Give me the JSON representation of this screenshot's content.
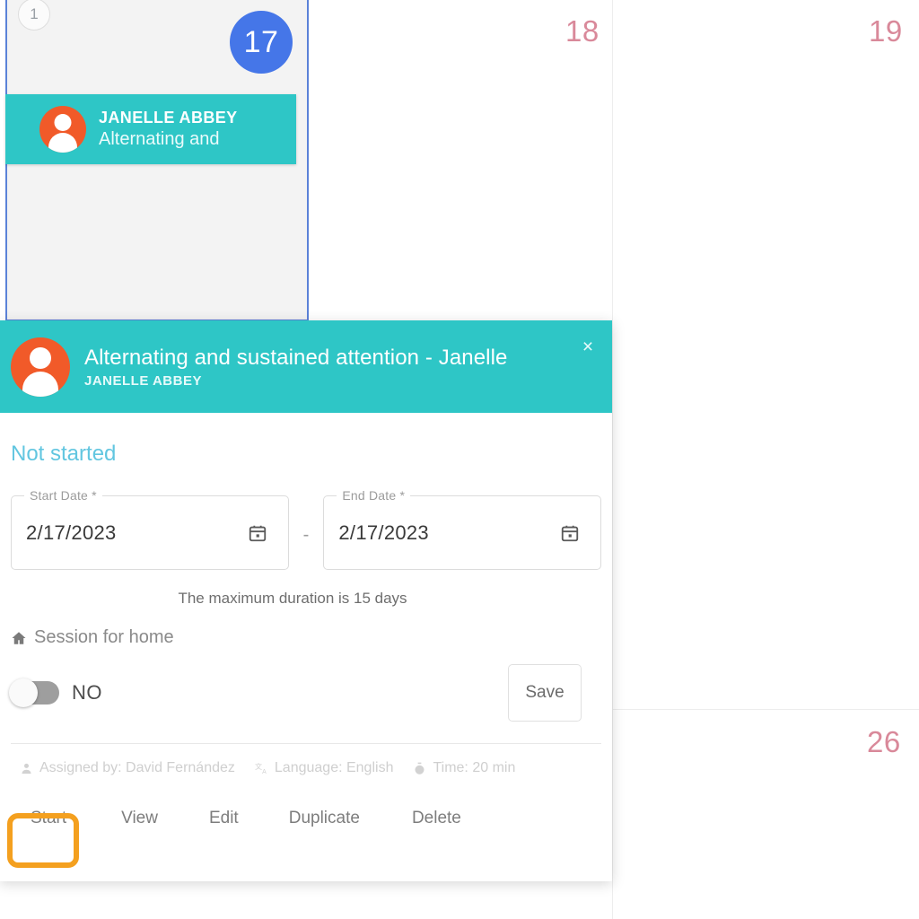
{
  "calendar": {
    "selected_day": {
      "number": "17",
      "event_count": "1",
      "event": {
        "client": "JANELLE ABBEY",
        "title": "Alternating and",
        "avatar_icon": "user-avatar-icon"
      }
    },
    "other_days": [
      {
        "number": "18"
      },
      {
        "number": "19"
      },
      {
        "number": "26"
      }
    ]
  },
  "popup": {
    "header": {
      "title": "Alternating and sustained attention - Janelle",
      "subtitle": "JANELLE ABBEY",
      "avatar_icon": "user-avatar-icon",
      "close_icon": "close-icon",
      "close_label": "×"
    },
    "status": "Not started",
    "start_date": {
      "label": "Start Date *",
      "value": "2/17/2023",
      "icon": "calendar-icon"
    },
    "date_separator": "-",
    "end_date": {
      "label": "End Date *",
      "value": "2/17/2023",
      "icon": "calendar-icon"
    },
    "max_duration_note": "The maximum duration is 15 days",
    "session_for_home": {
      "label": "Session for home",
      "icon": "home-icon",
      "toggle_value": "NO",
      "toggle_state": "off"
    },
    "save_label": "Save",
    "meta": [
      {
        "icon": "person-icon",
        "text": "Assigned by: David Fernández"
      },
      {
        "icon": "language-icon",
        "text": "Language: English"
      },
      {
        "icon": "stopwatch-icon",
        "text": "Time: 20 min"
      }
    ],
    "actions": [
      {
        "key": "start",
        "label": "Start"
      },
      {
        "key": "view",
        "label": "View"
      },
      {
        "key": "edit",
        "label": "Edit"
      },
      {
        "key": "duplicate",
        "label": "Duplicate"
      },
      {
        "key": "delete",
        "label": "Delete"
      }
    ]
  },
  "colors": {
    "teal": "#2ec6c6",
    "orange_avatar": "#f15a29",
    "blue_today": "#4576e8",
    "status_blue": "#62c6e0",
    "day_number_red": "#d9899a",
    "focus_orange": "#f4a01f",
    "selected_cell_border": "#5b82d8"
  }
}
